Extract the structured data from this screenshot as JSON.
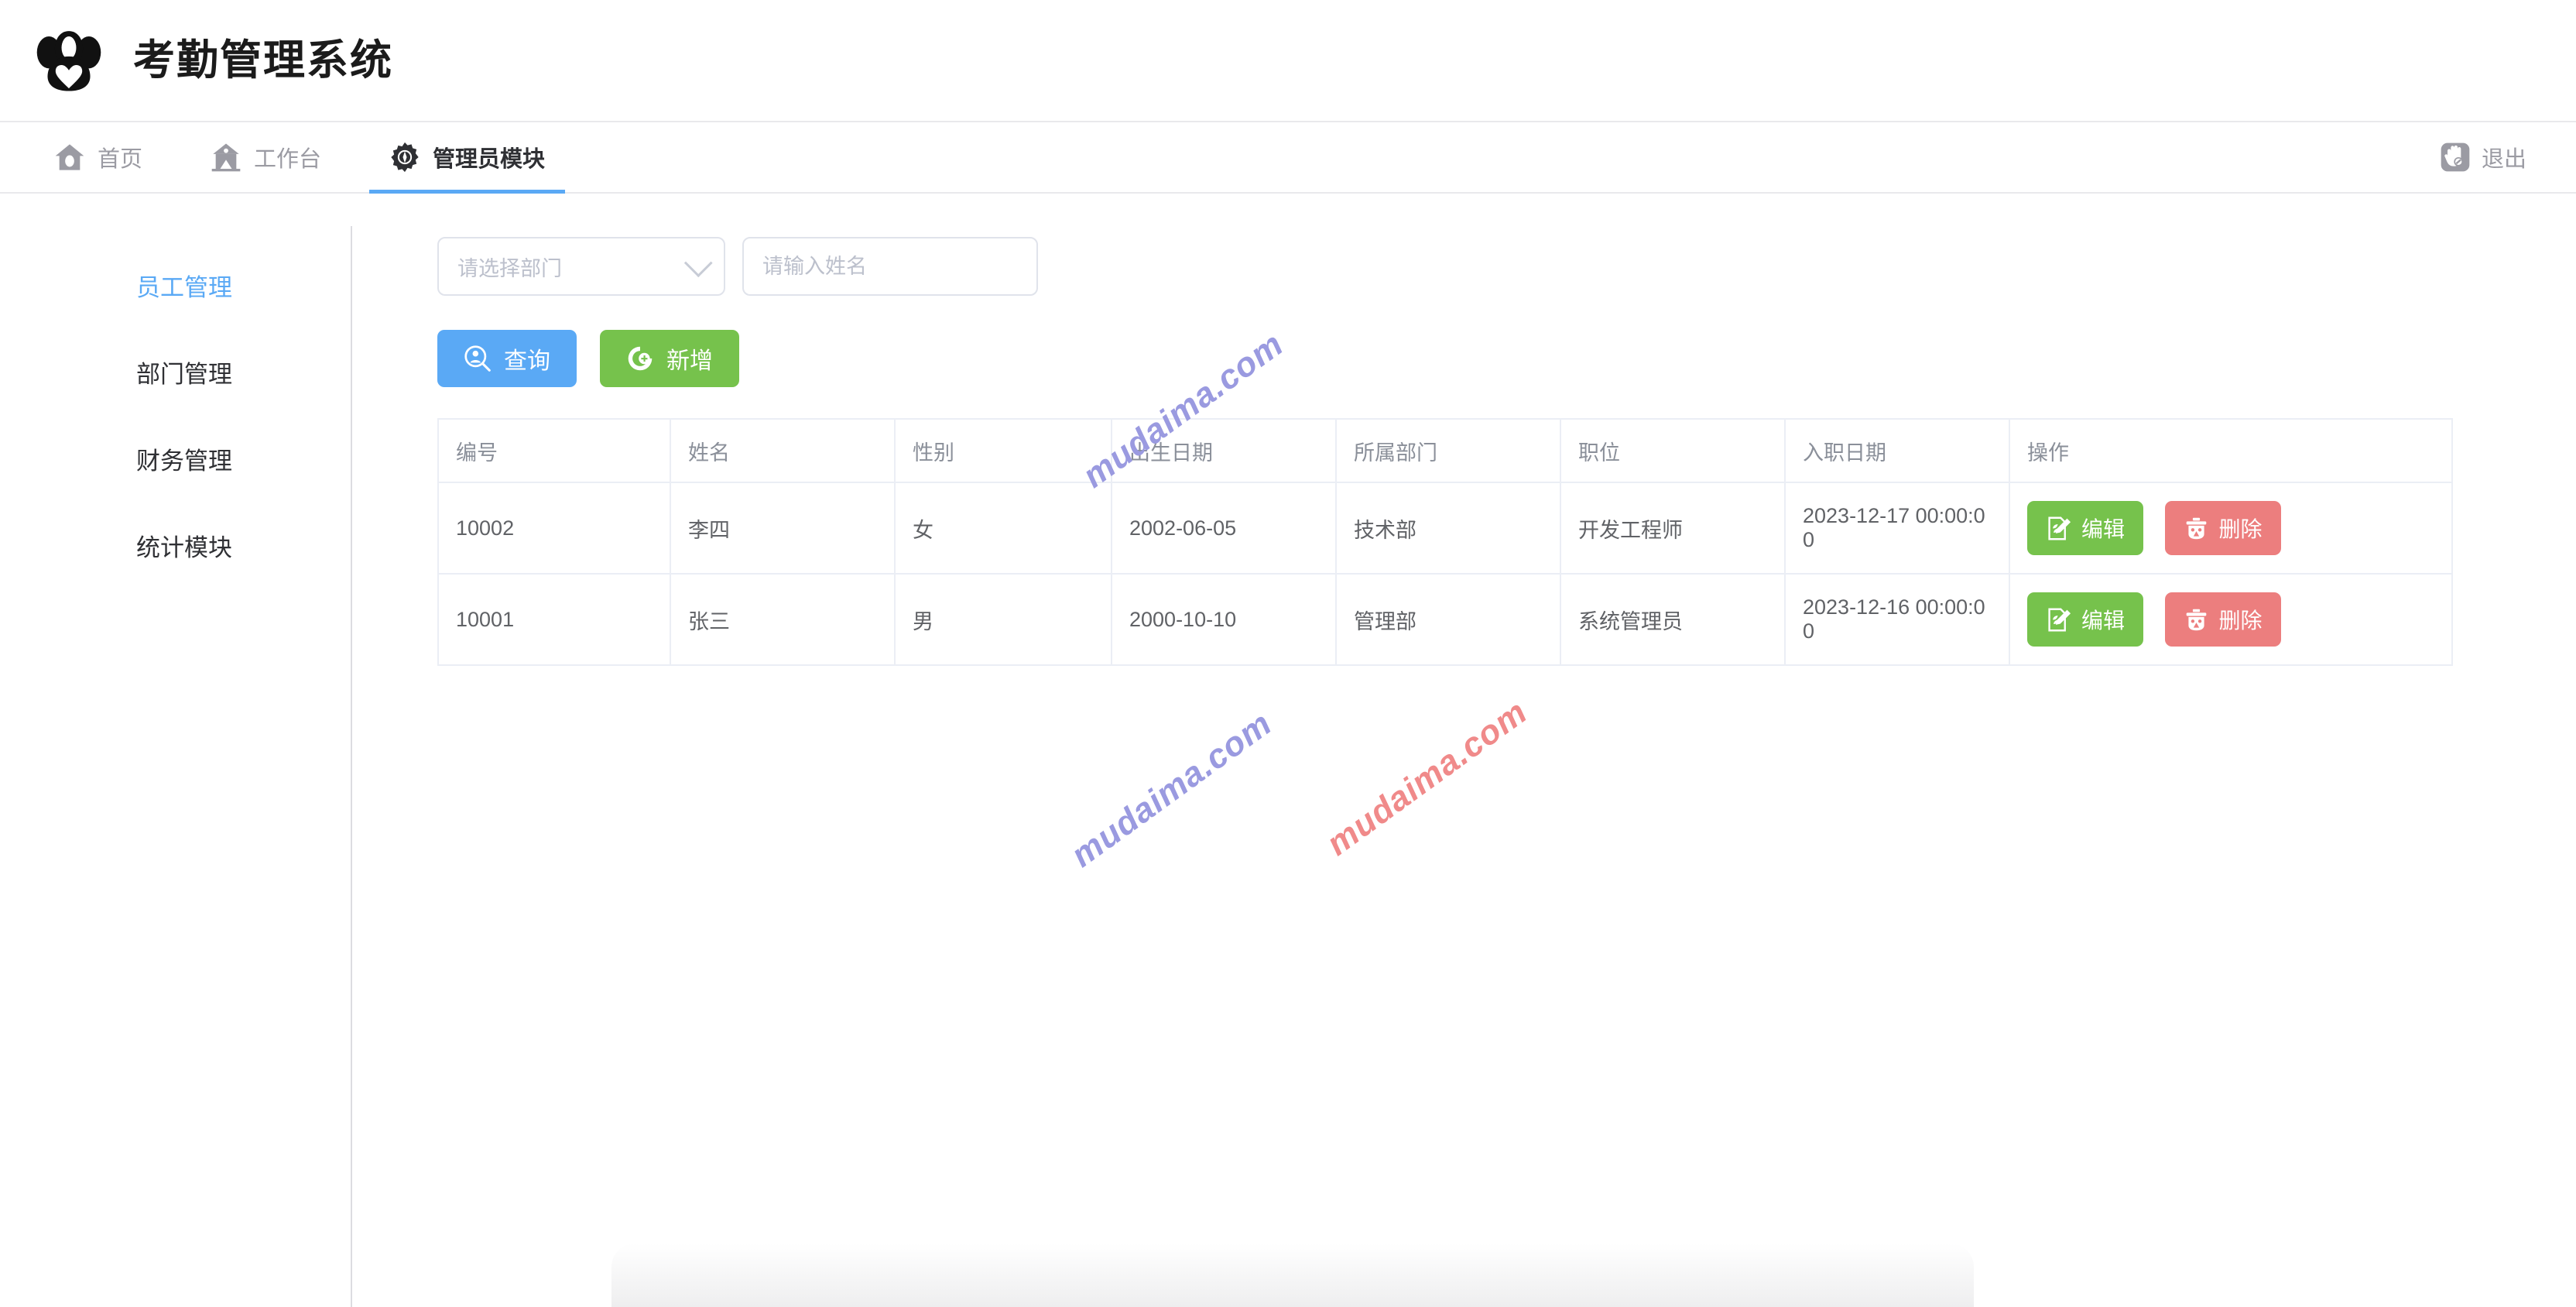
{
  "header": {
    "logo_icon": "two-people-heart-logo-icon",
    "title": "考勤管理系统"
  },
  "nav": {
    "items": [
      {
        "label": "首页",
        "icon": "home-icon",
        "active": false
      },
      {
        "label": "工作台",
        "icon": "workbench-building-icon",
        "active": false
      },
      {
        "label": "管理员模块",
        "icon": "gear-icon",
        "active": true
      }
    ],
    "logout": {
      "label": "退出",
      "icon": "logout-hand-icon"
    },
    "active_underline_color": "#5aa9f5"
  },
  "sidebar": {
    "items": [
      {
        "label": "员工管理",
        "active": true
      },
      {
        "label": "部门管理",
        "active": false
      },
      {
        "label": "财务管理",
        "active": false
      },
      {
        "label": "统计模块",
        "active": false
      }
    ],
    "active_color": "#5aa9f5"
  },
  "filters": {
    "department_select": {
      "placeholder": "请选择部门",
      "value": "",
      "icon": "chevron-down-icon"
    },
    "name_input": {
      "placeholder": "请输入姓名",
      "value": ""
    }
  },
  "actions": {
    "search": {
      "label": "查询",
      "icon": "search-user-icon",
      "color": "#5aa9f5"
    },
    "add": {
      "label": "新增",
      "icon": "plus-circle-icon",
      "color": "#76c24c"
    }
  },
  "table": {
    "columns": [
      "编号",
      "姓名",
      "性别",
      "出生日期",
      "所属部门",
      "职位",
      "入职日期",
      "操作"
    ],
    "rows": [
      {
        "id": "10002",
        "name": "李四",
        "gender": "女",
        "birth": "2002-06-05",
        "department": "技术部",
        "position": "开发工程师",
        "hire_date": "2023-12-17 00:00:00"
      },
      {
        "id": "10001",
        "name": "张三",
        "gender": "男",
        "birth": "2000-10-10",
        "department": "管理部",
        "position": "系统管理员",
        "hire_date": "2023-12-16 00:00:00"
      }
    ],
    "row_actions": {
      "edit": {
        "label": "编辑",
        "icon": "edit-pencil-icon",
        "color": "#76c24c"
      },
      "delete": {
        "label": "删除",
        "icon": "trash-icon",
        "color": "#ec7e7e"
      }
    }
  },
  "watermarks": [
    {
      "text": "mudaima.com",
      "color": "#9a9ae0"
    },
    {
      "text": "mudaima.com",
      "color": "#9a9ae0"
    },
    {
      "text": "mudaima.com",
      "color": "#f08a8a"
    }
  ]
}
